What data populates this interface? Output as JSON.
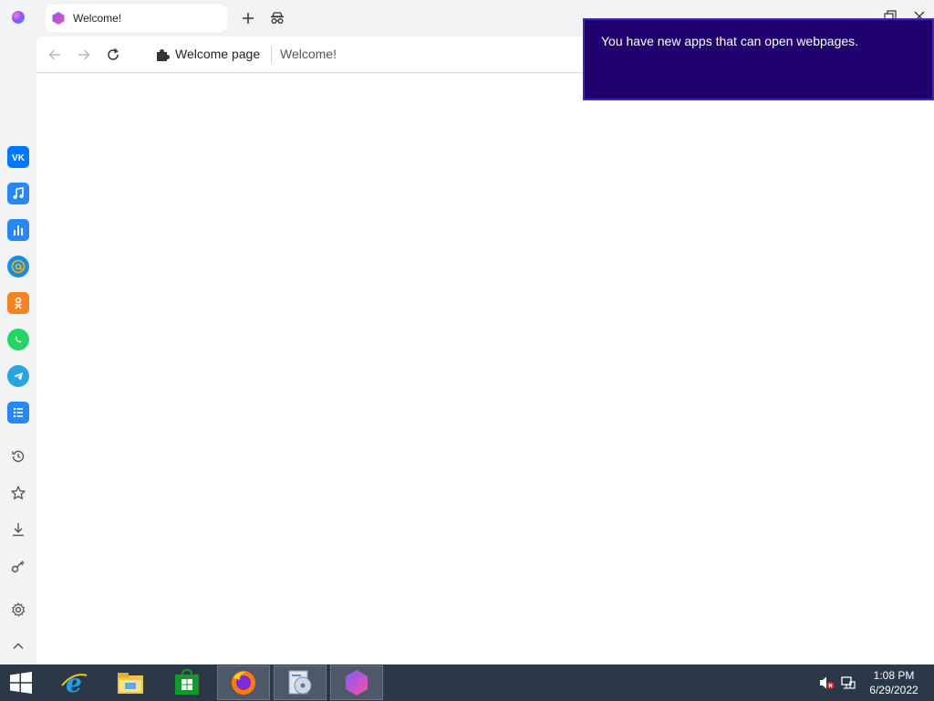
{
  "browser": {
    "tab": {
      "title": "Welcome!"
    },
    "address": {
      "site_label": "Welcome page",
      "page_title": "Welcome!"
    }
  },
  "sidebar": {
    "apps": [
      {
        "name": "vk",
        "icon": "vk-icon",
        "color": "#0077ff"
      },
      {
        "name": "music",
        "icon": "music-note-icon",
        "color": "#2787f5"
      },
      {
        "name": "stats",
        "icon": "bar-chart-icon",
        "color": "#2787f5"
      },
      {
        "name": "mail",
        "icon": "at-sign-icon",
        "color": "#168de2"
      },
      {
        "name": "odnoklassniki",
        "icon": "ok-icon",
        "color": "#f58220"
      },
      {
        "name": "whatsapp",
        "icon": "whatsapp-icon",
        "color": "#25d366"
      },
      {
        "name": "telegram",
        "icon": "telegram-icon",
        "color": "#2aa3df"
      },
      {
        "name": "tasks",
        "icon": "list-icon",
        "color": "#2787f5"
      }
    ],
    "tools": [
      "history-icon",
      "star-icon",
      "download-icon",
      "key-icon",
      "gear-icon",
      "chevron-up-icon"
    ]
  },
  "notification": {
    "text": "You have new apps that can open webpages."
  },
  "taskbar": {
    "items": [
      "internet-explorer-icon",
      "file-explorer-icon",
      "store-icon",
      "firefox-icon",
      "media-center-icon",
      "atom-browser-icon"
    ],
    "clock": {
      "time": "1:08 PM",
      "date": "6/29/2022"
    }
  },
  "colors": {
    "notification_bg": "#1f006d",
    "taskbar_bg": "#2b3848",
    "sidebar_bg": "#f2f3f5"
  }
}
